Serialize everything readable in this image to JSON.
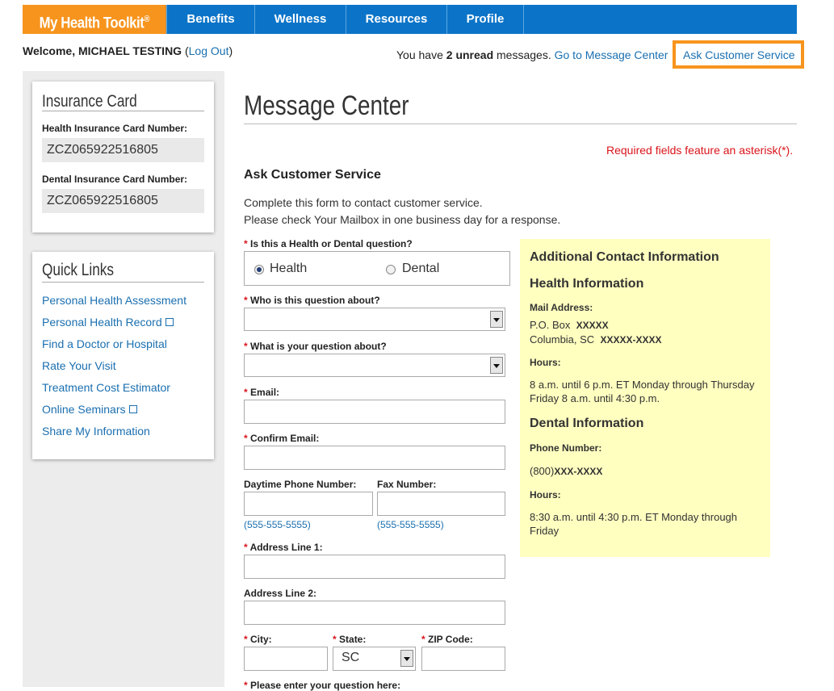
{
  "nav": {
    "brand": "My Health Toolkit",
    "brand_mark": "®",
    "tabs": [
      "Benefits",
      "Wellness",
      "Resources",
      "Profile"
    ]
  },
  "header": {
    "welcome_prefix": "Welcome, MICHAEL TESTING",
    "logout": "Log Out",
    "messages_prefix": "You have ",
    "unread_count": "2 unread",
    "messages_suffix": " messages.",
    "message_center_link": "Go to Message Center",
    "ask_cs_link": "Ask Customer Service"
  },
  "insurance_card": {
    "title": "Insurance Card",
    "health_label": "Health Insurance Card Number:",
    "health_value": "ZCZ065922516805",
    "dental_label": "Dental Insurance Card Number:",
    "dental_value": "ZCZ065922516805"
  },
  "quick_links": {
    "title": "Quick Links",
    "items": [
      "Personal Health Assessment",
      "Personal Health Record",
      "Find a Doctor or Hospital",
      "Rate Your Visit",
      "Treatment Cost Estimator",
      "Online Seminars",
      "Share My Information"
    ]
  },
  "main": {
    "title": "Message Center",
    "required_note": "Required fields feature an asterisk(*).",
    "form_title": "Ask Customer Service",
    "intro_1": "Complete this form to contact customer service.",
    "intro_2": "Please check Your Mailbox in one business day for a response."
  },
  "form": {
    "q_type_label": "Is this a Health or Dental question?",
    "q_type_options": [
      "Health",
      "Dental"
    ],
    "q_type_selected": "Health",
    "who_label": "Who is this question about?",
    "what_label": "What is your question about?",
    "email_label": "Email:",
    "confirm_email_label": "Confirm Email:",
    "phone_label": "Daytime Phone Number:",
    "phone_hint": "(555-555-5555)",
    "fax_label": "Fax Number:",
    "fax_hint": "(555-555-5555)",
    "address1_label": "Address Line 1:",
    "address2_label": "Address Line 2:",
    "city_label": "City:",
    "state_label": "State:",
    "state_value": "SC",
    "zip_label": "ZIP Code:",
    "question_label": "Please enter your question here:"
  },
  "info": {
    "title": "Additional Contact Information",
    "health_heading": "Health Information",
    "mail_label": "Mail Address:",
    "po_box": "P.O. Box",
    "po_box_value": "XXXXX",
    "city_line": "Columbia, SC",
    "zip_value": "XXXXX-XXXX",
    "hours_label": "Hours:",
    "health_hours_1": "8 a.m. until 6 p.m. ET Monday through Thursday",
    "health_hours_2": "Friday 8 a.m. until 4:30 p.m.",
    "dental_heading": "Dental Information",
    "phone_label": "Phone Number:",
    "phone_area": "(800)",
    "phone_value": "XXX-XXXX",
    "dental_hours_label": "Hours:",
    "dental_hours_1": "8:30 a.m. until 4:30 p.m. ET Monday through",
    "dental_hours_2": "Friday"
  },
  "colors": {
    "brand_orange": "#f7941d",
    "nav_blue": "#0b74c8",
    "link_blue": "#1a6fb0",
    "required_red": "#d9141a",
    "info_yellow": "#ffffc0"
  }
}
